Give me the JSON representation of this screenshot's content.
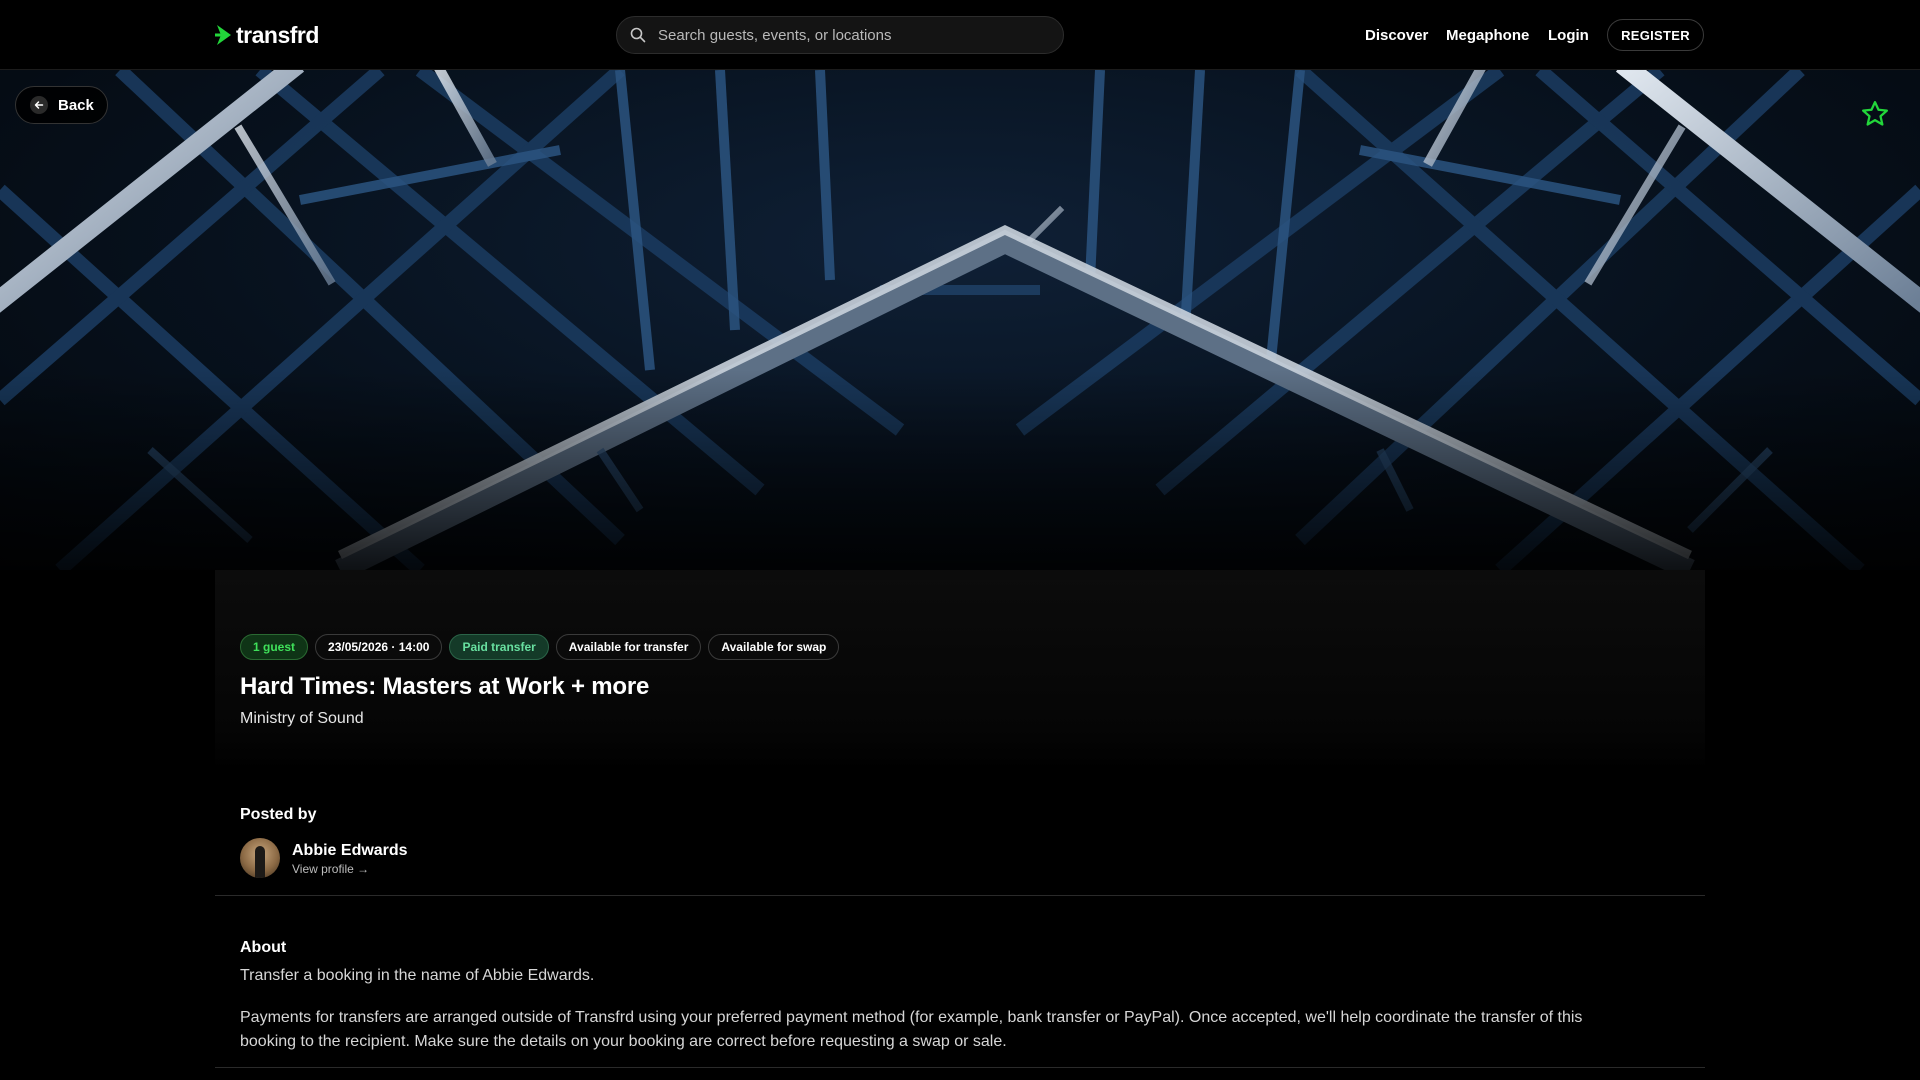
{
  "header": {
    "logo_text": "transfrd",
    "brand_color": "#22d63a",
    "search_placeholder": "Search guests, events, or locations",
    "nav": {
      "discover": "Discover",
      "megaphone": "Megaphone",
      "login": "Login",
      "register": "REGISTER"
    }
  },
  "hero": {
    "back_label": "Back",
    "favorite_icon": "star-icon"
  },
  "event": {
    "tags": {
      "guests": "1 guest",
      "datetime": "23/05/2026 · 14:00",
      "paid": "Paid transfer",
      "transfer": "Available for transfer",
      "swap": "Available for swap"
    },
    "title": "Hard Times: Masters at Work + more",
    "venue": "Ministry of Sound"
  },
  "posted_by": {
    "heading": "Posted by",
    "name": "Abbie Edwards",
    "view_profile": "View profile →"
  },
  "about": {
    "heading": "About",
    "p1": "Transfer a booking in the name of Abbie Edwards.",
    "p2": "Payments for transfers are arranged outside of Transfrd using your preferred payment method (for example, bank transfer or PayPal). Once accepted, we'll help coordinate the transfer of this booking to the recipient. Make sure the details on your booking are correct before requesting a swap or sale."
  }
}
